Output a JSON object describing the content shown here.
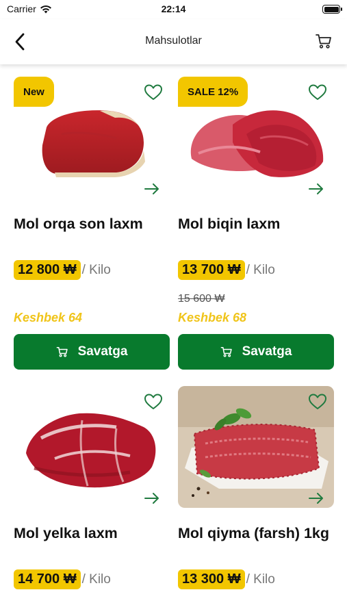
{
  "status_bar": {
    "carrier": "Carrier",
    "time": "22:14"
  },
  "header": {
    "title": "Mahsulotlar"
  },
  "products": [
    {
      "name": "Mol orqa son laxm",
      "badge": "New",
      "price": "12 800 ₩",
      "unit": "/ Kilo",
      "cashback": "Keshbek 64",
      "button_label": "Savatga"
    },
    {
      "name": "Mol biqin laxm",
      "badge": "SALE 12%",
      "price": "13 700 ₩",
      "unit": "/ Kilo",
      "old_price": "15 600 ₩",
      "cashback": "Keshbek 68",
      "button_label": "Savatga"
    },
    {
      "name": "Mol yelka laxm",
      "price": "14 700 ₩",
      "unit": "/ Kilo"
    },
    {
      "name": "Mol qiyma (farsh) 1kg",
      "price": "13 300 ₩",
      "unit": "/ Kilo"
    }
  ],
  "icons": {
    "favorite": "heart-outline-icon",
    "open": "arrow-right-icon",
    "cart": "cart-icon",
    "back": "chevron-left-icon"
  },
  "colors": {
    "accent_green": "#087a2d",
    "badge_yellow": "#f2c600",
    "cashback_yellow": "#f0c419",
    "icon_green": "#1f7a3f"
  }
}
